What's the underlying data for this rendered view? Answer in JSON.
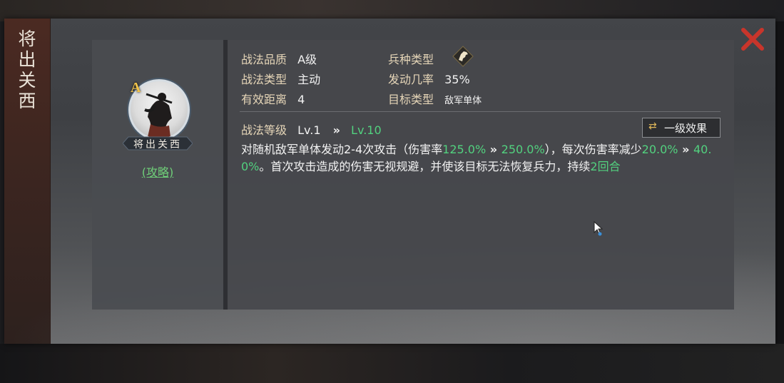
{
  "skill": {
    "name": "将出关西",
    "title_vertical": "将出关西",
    "grade": "A",
    "guide_link": "(攻略)"
  },
  "attributes": {
    "quality_label": "战法品质",
    "quality_value": "A级",
    "type_label": "战法类型",
    "type_value": "主动",
    "range_label": "有效距离",
    "range_value": "4",
    "troop_label": "兵种类型",
    "troop_icon": "cavalry-horse-icon",
    "rate_label": "发动几率",
    "rate_value": "35%",
    "target_label": "目标类型",
    "target_value": "敌军单体"
  },
  "level": {
    "label": "战法等级",
    "current": "Lv.1",
    "arrow": "»",
    "max": "Lv.10",
    "effect_button": "一级效果",
    "effect_button_icon": "swap-arrows-icon"
  },
  "description": {
    "p1": "对随机敌军单体发动2-4次攻击（伤害率",
    "p2": "125.0%",
    "p3": " » ",
    "p4": "250.0%",
    "p5": "），每次伤害率减少",
    "p6": "20.0%",
    "p7": " » ",
    "p8": "40.0%",
    "p9": "。首次攻击造成的伤害无视规避，并使该目标无法恢复兵力，持续",
    "p10": "2回合"
  },
  "colors": {
    "accent_green": "#52d17f",
    "label_gold": "#e6d6b8",
    "close_red": "#c8352b",
    "grade_gold": "#f0c34a"
  }
}
